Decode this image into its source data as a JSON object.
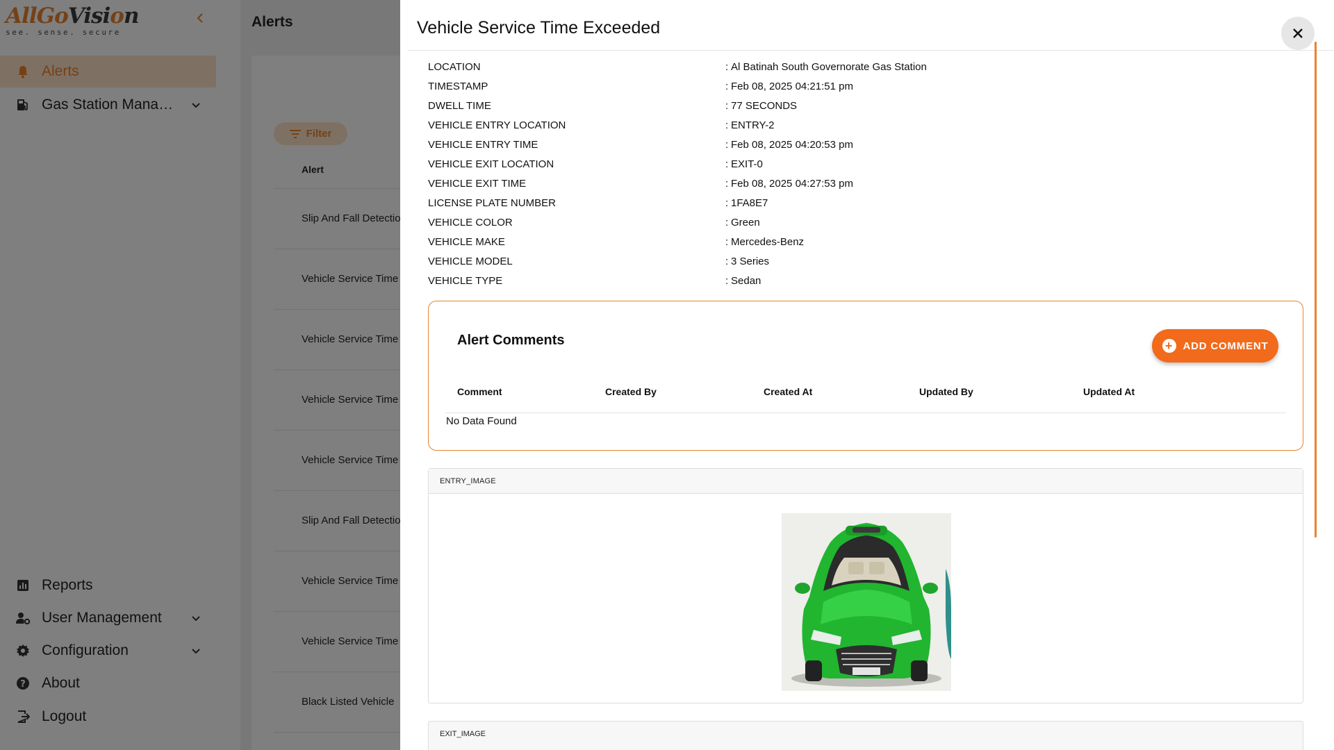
{
  "sidebar": {
    "logo": {
      "part1": "All",
      "part2": "Go",
      "part3": "Visi",
      "part4": "o",
      "part5": "n",
      "tagline": "see. sense. secure"
    },
    "items": [
      {
        "label": "Alerts",
        "icon": "bell-icon",
        "active": true
      },
      {
        "label": "Gas Station Manage...",
        "icon": "fuel-icon",
        "expandable": true
      },
      {
        "label": "Reports",
        "icon": "chart-icon"
      },
      {
        "label": "User Management",
        "icon": "user-gear-icon",
        "expandable": true
      },
      {
        "label": "Configuration",
        "icon": "gear-icon",
        "expandable": true
      },
      {
        "label": "About",
        "icon": "help-icon"
      },
      {
        "label": "Logout",
        "icon": "logout-icon"
      }
    ]
  },
  "main": {
    "title": "Alerts",
    "filter_label": "Filter",
    "column_alert": "Alert",
    "alerts": [
      "Slip And Fall Detection",
      "Vehicle Service Time Exc",
      "Vehicle Service Time Exc",
      "Vehicle Service Time Exc",
      "Vehicle Service Time Exc",
      "Slip And Fall Detection",
      "Vehicle Service Time Exc",
      "Vehicle Service Time Exc",
      "Black Listed Vehicle"
    ]
  },
  "drawer": {
    "title": "Vehicle Service Time Exceeded",
    "details": [
      {
        "key": "LOCATION",
        "value": "Al Batinah South Governorate Gas Station"
      },
      {
        "key": "TIMESTAMP",
        "value": "Feb 08, 2025 04:21:51 pm"
      },
      {
        "key": "DWELL TIME",
        "value": "77 SECONDS"
      },
      {
        "key": "VEHICLE ENTRY LOCATION",
        "value": "ENTRY-2"
      },
      {
        "key": "VEHICLE ENTRY TIME",
        "value": "Feb 08, 2025 04:20:53 pm"
      },
      {
        "key": "VEHICLE EXIT LOCATION",
        "value": "EXIT-0"
      },
      {
        "key": "VEHICLE EXIT TIME",
        "value": "Feb 08, 2025 04:27:53 pm"
      },
      {
        "key": "LICENSE PLATE NUMBER",
        "value": "1FA8E7"
      },
      {
        "key": "VEHICLE COLOR",
        "value": "Green"
      },
      {
        "key": "VEHICLE MAKE",
        "value": "Mercedes-Benz"
      },
      {
        "key": "VEHICLE MODEL",
        "value": "3 Series"
      },
      {
        "key": "VEHICLE TYPE",
        "value": "Sedan"
      }
    ],
    "comments": {
      "title": "Alert Comments",
      "add_label": "ADD COMMENT",
      "columns": [
        "Comment",
        "Created By",
        "Created At",
        "Updated By",
        "Updated At"
      ],
      "empty_text": "No Data Found"
    },
    "entry_image_label": "ENTRY_IMAGE",
    "exit_image_label": "EXIT_IMAGE"
  },
  "colors": {
    "accent": "#e8822f",
    "button": "#f26a1b",
    "active_bg": "#fde2c7",
    "overlay": "rgba(0,0,0,0.5)"
  }
}
